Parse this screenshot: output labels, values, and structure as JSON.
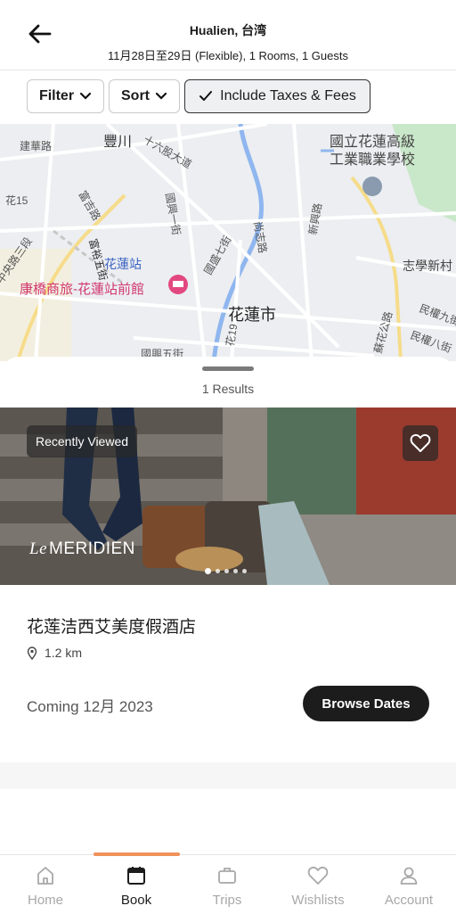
{
  "header": {
    "title": "Hualien, 台湾",
    "subtitle": "11月28日至29日 (Flexible), 1 Rooms, 1 Guests"
  },
  "filters": {
    "filter_label": "Filter",
    "sort_label": "Sort",
    "taxes_label": "Include Taxes & Fees"
  },
  "map": {
    "labels": {
      "jianhua_rd": "建華路",
      "fengchuan": "豐川",
      "shiliugu": "十六股大道",
      "university": "國立花蓮高級",
      "university2": "工業職業學校",
      "hua15": "花15",
      "fuxing_rd": "富吉路",
      "guoxing1": "國興一街",
      "fuyu5": "富裕五街",
      "station": "花蓮站",
      "hotel": "康橋商旅-花蓮站前館",
      "zhongyang": "中央路三段",
      "guosheng7": "國盛七街",
      "shangzhi": "尚志路",
      "xinxing": "新興路",
      "zhixue": "志學新村",
      "hualien_city": "花蓮市",
      "minquan9": "民權九街",
      "minquan8": "民權八街",
      "guoxing5": "國興五街",
      "hua19": "花19",
      "suhua": "蘇花公路"
    },
    "colors": {
      "road": "#ffffff",
      "highway": "#f6dc8a",
      "water": "#8fb6ef",
      "park": "#c9e7c9",
      "poi": "#e2487e"
    }
  },
  "results": {
    "count_text": "1 Results"
  },
  "hotel": {
    "recently_viewed": "Recently Viewed",
    "brand_prefix": "Le",
    "brand_name": "MERIDIEN",
    "name": "花莲洁西艾美度假酒店",
    "distance": "1.2 km",
    "status": "Coming 12月 2023",
    "browse_label": "Browse Dates",
    "photo_index": 1,
    "photo_count": 5
  },
  "tabs": [
    {
      "label": "Home",
      "icon": "home-icon",
      "selected": false
    },
    {
      "label": "Book",
      "icon": "calendar-icon",
      "selected": true
    },
    {
      "label": "Trips",
      "icon": "suitcase-icon",
      "selected": false
    },
    {
      "label": "Wishlists",
      "icon": "heart-icon",
      "selected": false
    },
    {
      "label": "Account",
      "icon": "person-icon",
      "selected": false
    }
  ]
}
